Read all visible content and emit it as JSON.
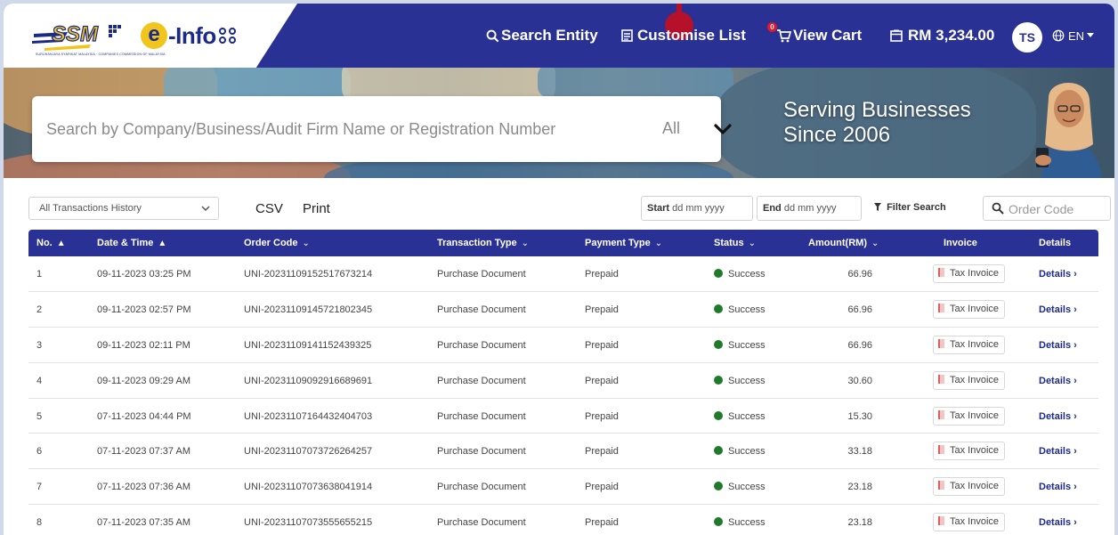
{
  "header": {
    "ssm_caption": "SURUHANJAYA SYARIKAT MALAYSIA · COMPANIES COMMISSION OF MALAYSIA",
    "einfo_logo": "e-Info",
    "nav": {
      "search": "Search Entity",
      "customise": "Customise List",
      "cart": "View Cart",
      "cart_count": "0",
      "wallet": "RM 3,234.00"
    },
    "avatar": "TS",
    "language": "EN"
  },
  "banner": {
    "search_placeholder": "Search by Company/Business/Audit Firm Name or Registration Number",
    "scope": "All",
    "tagline_line1": "Serving Businesses",
    "tagline_line2": "Since 2006"
  },
  "toolbar": {
    "history_select": "All Transactions History",
    "csv": "CSV",
    "print": "Print",
    "start_label": "Start",
    "start_placeholder": "dd  mm  yyyy",
    "end_label": "End",
    "end_placeholder": "dd  mm  yyyy",
    "filter": "Filter Search",
    "order_placeholder": "Order Code"
  },
  "table": {
    "headers": {
      "no": "No.",
      "date": "Date & Time",
      "order": "Order Code",
      "type": "Transaction Type",
      "payment": "Payment Type",
      "status": "Status",
      "amount": "Amount(RM)",
      "invoice": "Invoice",
      "details": "Details"
    },
    "rows": [
      {
        "no": "1",
        "date": "09-11-2023 03:25 PM",
        "order": "UNI-20231109152517673214",
        "type": "Purchase Document",
        "payment": "Prepaid",
        "status": "Success",
        "amount": "66.96",
        "invoice": "Tax Invoice",
        "details": "Details"
      },
      {
        "no": "2",
        "date": "09-11-2023 02:57 PM",
        "order": "UNI-20231109145721802345",
        "type": "Purchase Document",
        "payment": "Prepaid",
        "status": "Success",
        "amount": "66.96",
        "invoice": "Tax Invoice",
        "details": "Details"
      },
      {
        "no": "3",
        "date": "09-11-2023 02:11 PM",
        "order": "UNI-20231109141152439325",
        "type": "Purchase Document",
        "payment": "Prepaid",
        "status": "Success",
        "amount": "66.96",
        "invoice": "Tax Invoice",
        "details": "Details"
      },
      {
        "no": "4",
        "date": "09-11-2023 09:29 AM",
        "order": "UNI-20231109092916689691",
        "type": "Purchase Document",
        "payment": "Prepaid",
        "status": "Success",
        "amount": "30.60",
        "invoice": "Tax Invoice",
        "details": "Details"
      },
      {
        "no": "5",
        "date": "07-11-2023 04:44 PM",
        "order": "UNI-20231107164432404703",
        "type": "Purchase Document",
        "payment": "Prepaid",
        "status": "Success",
        "amount": "15.30",
        "invoice": "Tax Invoice",
        "details": "Details"
      },
      {
        "no": "6",
        "date": "07-11-2023 07:37 AM",
        "order": "UNI-20231107073726264257",
        "type": "Purchase Document",
        "payment": "Prepaid",
        "status": "Success",
        "amount": "33.18",
        "invoice": "Tax Invoice",
        "details": "Details"
      },
      {
        "no": "7",
        "date": "07-11-2023 07:36 AM",
        "order": "UNI-20231107073638041914",
        "type": "Purchase Document",
        "payment": "Prepaid",
        "status": "Success",
        "amount": "23.18",
        "invoice": "Tax Invoice",
        "details": "Details"
      },
      {
        "no": "8",
        "date": "07-11-2023 07:35 AM",
        "order": "UNI-20231107073555655215",
        "type": "Purchase Document",
        "payment": "Prepaid",
        "status": "Success",
        "amount": "23.18",
        "invoice": "Tax Invoice",
        "details": "Details"
      }
    ]
  },
  "colors": {
    "brand_navy": "#2a3194",
    "marker_red": "#b5112a",
    "success_green": "#1f7a2a",
    "logo_yellow": "#f2c51c"
  },
  "icons": {
    "search": "search-icon",
    "customise": "list-icon",
    "cart": "cart-icon",
    "wallet": "wallet-icon",
    "language": "globe-icon",
    "filter": "filter-icon",
    "invoice": "pdf-icon"
  }
}
